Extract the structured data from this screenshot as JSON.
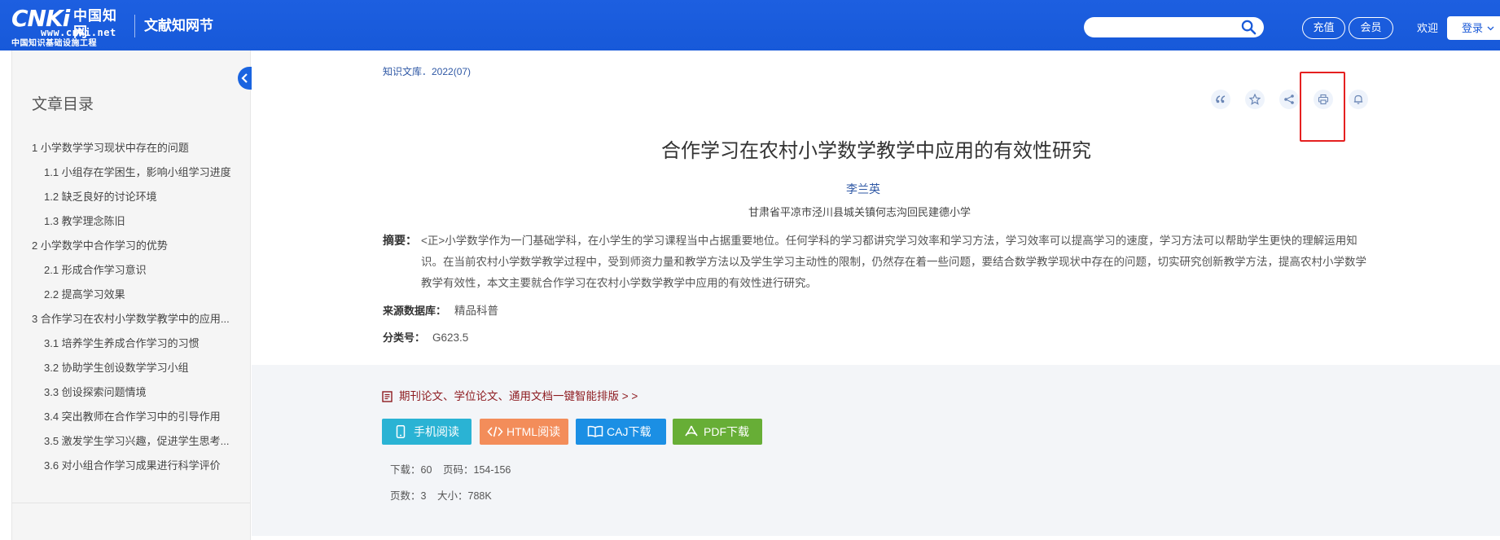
{
  "header": {
    "logo_mark": "CNKi",
    "logo_cn": "中国知网",
    "logo_url": "www.cnki.net",
    "logo_sub": "中国知识基础设施工程",
    "site_name": "文献知网节",
    "search_placeholder": "",
    "recharge_label": "充值",
    "member_label": "会员",
    "welcome_text": "欢迎",
    "login_label": "登录"
  },
  "sidebar": {
    "title": "文章目录",
    "items": [
      {
        "label": "1 小学数学学习现状中存在的问题",
        "level": 1
      },
      {
        "label": "1.1 小组存在学困生，影响小组学习进度",
        "level": 2
      },
      {
        "label": "1.2 缺乏良好的讨论环境",
        "level": 2
      },
      {
        "label": "1.3 教学理念陈旧",
        "level": 2
      },
      {
        "label": "2 小学数学中合作学习的优势",
        "level": 1
      },
      {
        "label": "2.1 形成合作学习意识",
        "level": 2
      },
      {
        "label": "2.2 提高学习效果",
        "level": 2
      },
      {
        "label": "3 合作学习在农村小学数学教学中的应用...",
        "level": 1
      },
      {
        "label": "3.1 培养学生养成合作学习的习惯",
        "level": 2
      },
      {
        "label": "3.2 协助学生创设数学学习小组",
        "level": 2
      },
      {
        "label": "3.3 创设探索问题情境",
        "level": 2
      },
      {
        "label": "3.4 突出教师在合作学习中的引导作用",
        "level": 2
      },
      {
        "label": "3.5 激发学生学习兴趣，促进学生思考...",
        "level": 2
      },
      {
        "label": "3.6 对小组合作学习成果进行科学评价",
        "level": 2
      }
    ]
  },
  "article": {
    "journal": "知识文库．2022(07)",
    "title": "合作学习在农村小学数学教学中应用的有效性研究",
    "author": "李兰英",
    "affiliation": "甘肃省平凉市泾川县城关镇何志沟回民建德小学",
    "abstract_label": "摘要：",
    "abstract_text": "<正>小学数学作为一门基础学科，在小学生的学习课程当中占据重要地位。任何学科的学习都讲究学习效率和学习方法，学习效率可以提高学习的速度，学习方法可以帮助学生更快的理解运用知识。在当前农村小学数学教学过程中，受到师资力量和教学方法以及学生学习主动性的限制，仍然存在着一些问题，要结合数学教学现状中存在的问题，切实研究创新教学方法，提高农村小学数学教学有效性，本文主要就合作学习在农村小学数学教学中应用的有效性进行研究。",
    "source_label": "来源数据库：",
    "source_value": "精品科普",
    "class_label": "分类号：",
    "class_value": "G623.5"
  },
  "toolbar": {
    "icons": [
      "quote-icon",
      "star-icon",
      "share-icon",
      "print-icon",
      "bell-icon"
    ],
    "highlight_color": "#e52020"
  },
  "downloads": {
    "promo_text": "期刊论文、学位论文、通用文档一键智能排版 > >",
    "mobile_read": "手机阅读",
    "html_read": "HTML阅读",
    "caj_download": "CAJ下载",
    "pdf_download": "PDF下载",
    "downloads_stat": "下载：60",
    "pages_range_stat": "页码：154-156",
    "page_count_stat": "页数：3",
    "size_stat": "大小：788K"
  },
  "colors": {
    "header_blue": "#1d5fe0",
    "link_blue": "#2f58a5",
    "mobile_btn": "#2ab3d4",
    "html_btn": "#f38d5a",
    "caj_btn": "#1b8fe4",
    "pdf_btn": "#67ae36",
    "promo_text": "#8d1a1f"
  }
}
